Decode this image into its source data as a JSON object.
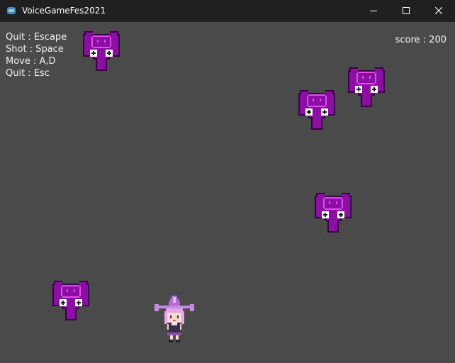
{
  "window": {
    "title": "VoiceGameFes2021",
    "icon": "godot-icon",
    "buttons": [
      "minimize-icon",
      "maximize-icon",
      "close-icon"
    ]
  },
  "hud": {
    "controls": [
      "Quit : Escape",
      "Shot : Space",
      "Move : A,D",
      "Quit : Esc"
    ],
    "score": "score : 200"
  },
  "colors": {
    "background": "#4a4a4a",
    "titlebar": "#202020",
    "enemy_body": "#8b0fa3",
    "enemy_outline": "#3a0046",
    "enemy_highlight": "#e04ef0",
    "player_hat": "#c88ae0"
  },
  "sprites": {
    "enemy": "purple-ghost-enemy",
    "player": "witch-girl-player"
  }
}
